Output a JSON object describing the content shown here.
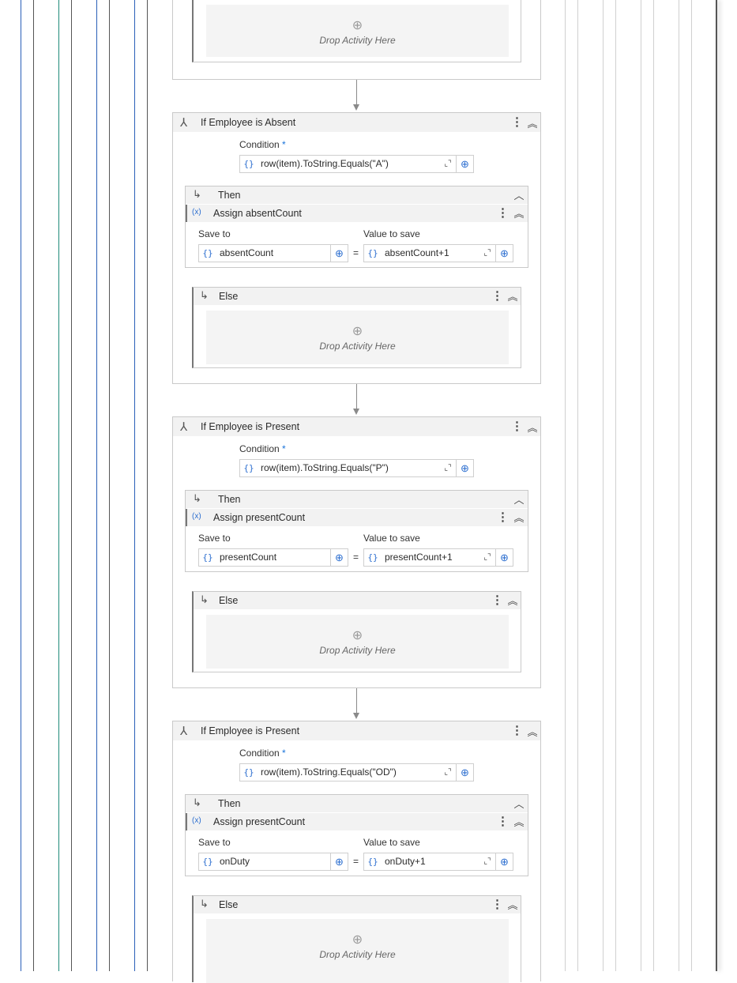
{
  "blocks": [
    {
      "title": "If Employee is Absent",
      "condition_label": "Condition",
      "condition_required": "*",
      "condition_value": "row(item).ToString.Equals(\"A\")",
      "then_label": "Then",
      "assign_title": "Assign absentCount",
      "save_to_label": "Save to",
      "value_label": "Value to save",
      "save_to_value": "absentCount",
      "value_value": "absentCount+1",
      "else_label": "Else",
      "drop_text": "Drop Activity Here"
    },
    {
      "title": "If Employee is Present",
      "condition_label": "Condition",
      "condition_required": "*",
      "condition_value": "row(item).ToString.Equals(\"P\")",
      "then_label": "Then",
      "assign_title": "Assign presentCount",
      "save_to_label": "Save to",
      "value_label": "Value to save",
      "save_to_value": "presentCount",
      "value_value": "presentCount+1",
      "else_label": "Else",
      "drop_text": "Drop Activity Here"
    },
    {
      "title": "If Employee is Present",
      "condition_label": "Condition",
      "condition_required": "*",
      "condition_value": "row(item).ToString.Equals(\"OD\")",
      "then_label": "Then",
      "assign_title": "Assign presentCount",
      "save_to_label": "Save to",
      "value_label": "Value to save",
      "save_to_value": "onDuty",
      "value_value": "onDuty+1",
      "else_label": "Else",
      "drop_text": "Drop Activity Here"
    }
  ],
  "top_drop": {
    "text": "Drop Activity Here"
  },
  "symbols": {
    "equals": "=",
    "brace": "{}",
    "variable": "(x)",
    "plus": "⊕",
    "expand": "⌞⌝",
    "more": "⋮",
    "collapse_double": "⌃",
    "collapse_single": "^",
    "branch": "↳",
    "if_icon": "⅄"
  },
  "colors": {
    "accent": "#2d6fd0",
    "header_bg": "#f2f2f2",
    "drop_bg": "#f4f4f4",
    "border": "#c9c9c9",
    "teal_guide": "#1f8a7a",
    "blue_guide": "#2a5fb8"
  }
}
